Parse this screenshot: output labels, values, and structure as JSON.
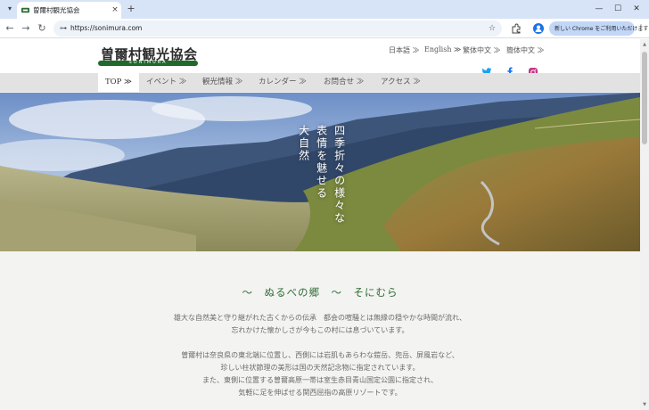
{
  "browser": {
    "tab_title": "曽爾村観光協会",
    "tab_close": "×",
    "newtab": "+",
    "url": "https://sonimura.com",
    "chrome_pill": "新しい Chrome をご利用いただけます",
    "win_min": "—",
    "win_max": "☐",
    "win_close": "✕",
    "back": "←",
    "forward": "→",
    "reload": "↻",
    "star": "☆",
    "menu": "⋮"
  },
  "header": {
    "logo_text": "曽爾村観光協会",
    "logo_sub": "SONIMURA",
    "languages": [
      "日本語 ≫",
      "English ≫",
      "繁体中文 ≫",
      "簡体中文 ≫"
    ],
    "social": [
      "twitter",
      "facebook",
      "instagram"
    ],
    "social_colors": {
      "twitter": "#1da1f2",
      "facebook": "#1877f2",
      "instagram": "#c13584"
    }
  },
  "nav": {
    "items": [
      "TOP ≫",
      "イベント ≫",
      "観光情報 ≫",
      "カレンダー ≫",
      "お問合せ ≫",
      "アクセス ≫"
    ]
  },
  "hero": {
    "line1": "四季折々の様々な",
    "line2": "表情を魅せる",
    "line3": "大自然"
  },
  "content": {
    "title": "～　ぬるべの郷　～　そにむら",
    "p1": [
      "雄大な自然美と守り継がれた古くからの伝承　都会の喧騒とは無縁の穏やかな時間が流れ、",
      "忘れかけた懐かしさが今もこの村には息づいています。"
    ],
    "p2": [
      "曽爾村は奈良県の東北端に位置し、西側には岩肌もあらわな鎧岳、兜岳、屏風岩など、",
      "珍しい柱状節理の美形は国の天然記念物に指定されています。",
      "また、東側に位置する曽爾高原一帯は室生赤目青山国定公園に指定され、",
      "気軽に足を伸ばせる関西屈指の高原リゾートです。"
    ]
  },
  "colors": {
    "accent": "#2e6d35",
    "logo_bar": "#1f6a2a",
    "nav_bg": "#e2e2e2"
  }
}
